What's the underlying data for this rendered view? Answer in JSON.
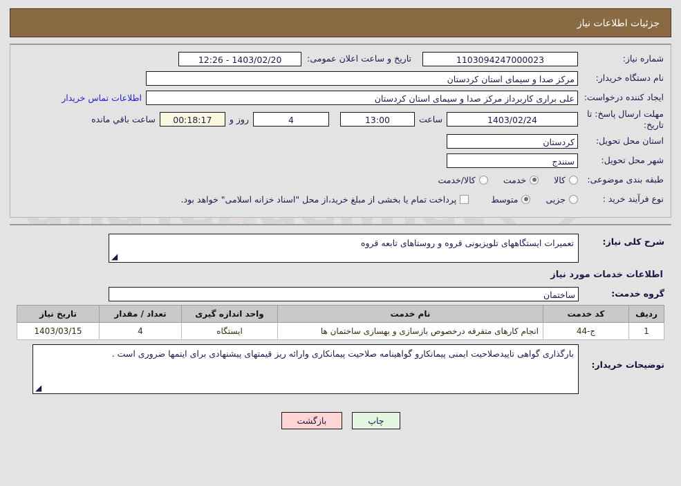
{
  "header": {
    "title": "جزئیات اطلاعات نیاز",
    "bg_color": "#8a6a42",
    "text_color": "#ffffff"
  },
  "info": {
    "need_number_label": "شماره نیاز:",
    "need_number_value": "1103094247000023",
    "public_announce_label": "تاریخ و ساعت اعلان عمومی:",
    "public_announce_value": "1403/02/20 - 12:26",
    "buyer_org_label": "نام دستگاه خریدار:",
    "buyer_org_value": "مرکز صدا و سیمای استان کردستان",
    "requester_label": "ایجاد کننده درخواست:",
    "requester_value": "علی براری کاربرداز مرکز صدا و سیمای استان کردستان",
    "contact_link": "اطلاعات تماس خریدار",
    "deadline_label": "مهلت ارسال پاسخ: تا تاریخ:",
    "deadline_date": "1403/02/24",
    "hour_label": "ساعت",
    "hour_value": "13:00",
    "days_value": "4",
    "days_label": "روز و",
    "countdown_value": "00:18:17",
    "remaining_label": "ساعت باقي مانده",
    "province_label": "استان محل تحویل:",
    "province_value": "کردستان",
    "city_label": "شهر محل تحویل:",
    "city_value": "سنندج",
    "category_label": "طبقه بندی موضوعی:",
    "category_options": [
      {
        "label": "کالا",
        "selected": false
      },
      {
        "label": "خدمت",
        "selected": true
      },
      {
        "label": "کالا/خدمت",
        "selected": false
      }
    ],
    "process_label": "نوع فرآیند خرید :",
    "process_options": [
      {
        "label": "جزیی",
        "selected": false
      },
      {
        "label": "متوسط",
        "selected": true
      }
    ],
    "treasury_checkbox_label": "پرداخت تمام یا بخشی از مبلغ خرید،از محل \"اسناد خزانه اسلامی\" خواهد بود.",
    "treasury_checked": false
  },
  "description": {
    "label": "شرح کلی نیاز:",
    "value": "تعمیرات ایستگاههای تلویزیونی قروه و روستاهای تابعه قروه"
  },
  "services": {
    "section_title": "اطلاعات خدمات مورد نیاز",
    "group_label": "گروه خدمت:",
    "group_value": "ساختمان",
    "table": {
      "columns": [
        "ردیف",
        "کد خدمت",
        "نام خدمت",
        "واحد اندازه گیری",
        "تعداد / مقدار",
        "تاریخ نیاز"
      ],
      "rows": [
        {
          "row": "1",
          "code": "ج-44",
          "name": "انجام کارهای متفرقه درخصوص بازسازی و بهسازی ساختمان ها",
          "unit": "ایستگاه",
          "quantity": "4",
          "date": "1403/03/15"
        }
      ]
    }
  },
  "buyer_notes": {
    "label": "توضیحات خریدار:",
    "value": "بارگذاری گواهی تاییدصلاحیت ایمنی پیمانکارو گواهینامه صلاحیت پیمانکاری وارائه ریز قیمتهای پیشنهادی برای ایتمها ضروری است ."
  },
  "buttons": {
    "print": "چاپ",
    "back": "بازگشت"
  },
  "watermark": {
    "text": "anaTender.net"
  }
}
